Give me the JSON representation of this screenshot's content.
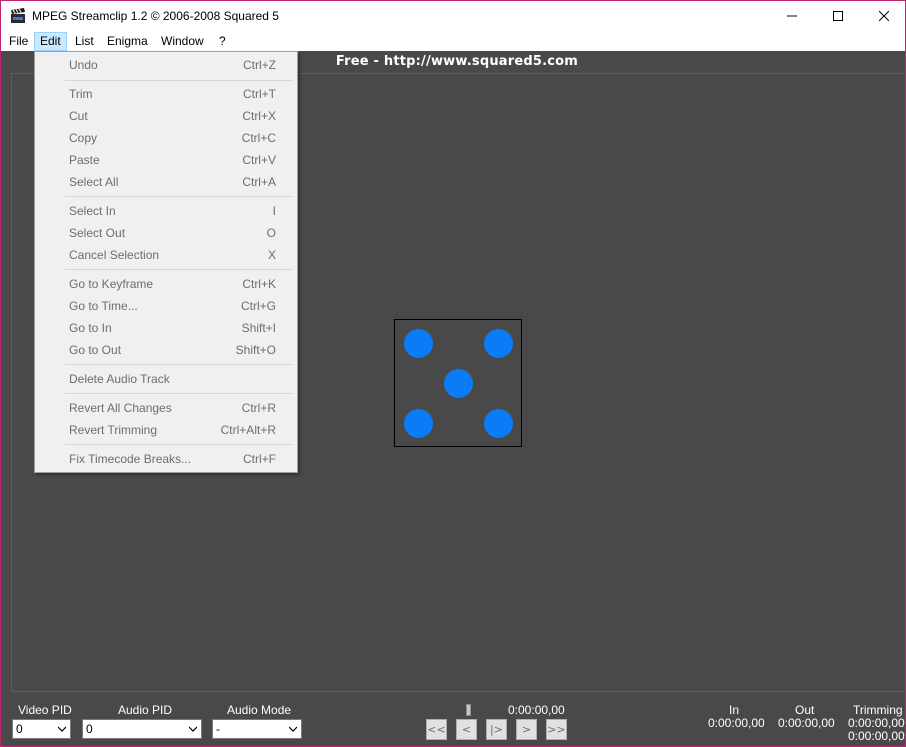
{
  "window": {
    "title": "MPEG Streamclip 1.2  ©  2006-2008 Squared 5",
    "controls": [
      "minimize",
      "maximize",
      "close"
    ]
  },
  "menubar": {
    "items": [
      {
        "label": "File"
      },
      {
        "label": "Edit",
        "active": true
      },
      {
        "label": "List"
      },
      {
        "label": "Enigma"
      },
      {
        "label": "Window"
      },
      {
        "label": "?"
      }
    ]
  },
  "banner": "Free  -  http://www.squared5.com",
  "edit_menu": {
    "items": [
      {
        "label": "Undo",
        "shortcut": "Ctrl+Z"
      },
      {
        "label": "Trim",
        "shortcut": "Ctrl+T"
      },
      {
        "label": "Cut",
        "shortcut": "Ctrl+X"
      },
      {
        "label": "Copy",
        "shortcut": "Ctrl+C"
      },
      {
        "label": "Paste",
        "shortcut": "Ctrl+V"
      },
      {
        "label": "Select All",
        "shortcut": "Ctrl+A"
      },
      {
        "label": "Select In",
        "shortcut": "I"
      },
      {
        "label": "Select Out",
        "shortcut": "O"
      },
      {
        "label": "Cancel Selection",
        "shortcut": "X"
      },
      {
        "label": "Go to Keyframe",
        "shortcut": "Ctrl+K"
      },
      {
        "label": "Go to Time...",
        "shortcut": "Ctrl+G"
      },
      {
        "label": "Go to In",
        "shortcut": "Shift+I"
      },
      {
        "label": "Go to Out",
        "shortcut": "Shift+O"
      },
      {
        "label": "Delete Audio Track",
        "shortcut": ""
      },
      {
        "label": "Revert All Changes",
        "shortcut": "Ctrl+R"
      },
      {
        "label": "Revert Trimming",
        "shortcut": "Ctrl+Alt+R"
      },
      {
        "label": "Fix Timecode Breaks...",
        "shortcut": "Ctrl+F"
      }
    ]
  },
  "bottom": {
    "video_pid": {
      "label": "Video PID",
      "value": "0"
    },
    "audio_pid": {
      "label": "Audio PID",
      "value": "0"
    },
    "audio_mode": {
      "label": "Audio Mode",
      "value": "-"
    },
    "current_time": "0:00:00,00",
    "transport": {
      "rewind_fast": "<<",
      "step_back": "<",
      "play": "|>",
      "step_forward": ">",
      "forward_fast": ">>"
    },
    "in": {
      "label": "In",
      "value": "0:00:00,00"
    },
    "out": {
      "label": "Out",
      "value": "0:00:00,00"
    },
    "trimming": {
      "label": "Trimming",
      "value1": "0:00:00,00",
      "value2": "0:00:00,00"
    }
  },
  "colors": {
    "background": "#494949",
    "accent_dot": "#0a7cf8",
    "menu_highlight": "#cce8ff",
    "window_border": "#b9276f"
  }
}
